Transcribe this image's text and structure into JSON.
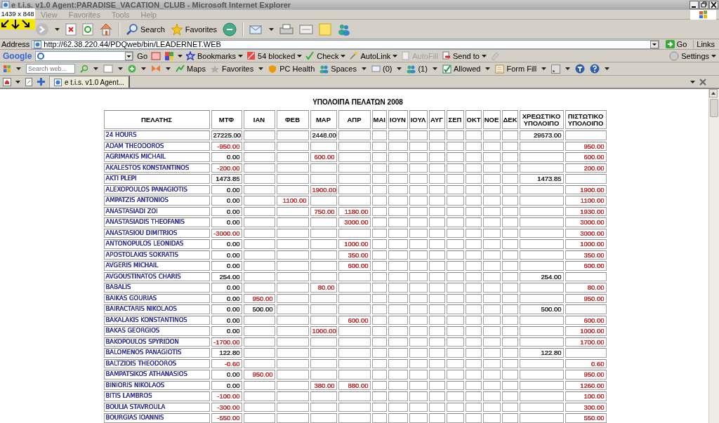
{
  "window": {
    "title": "e t.i.s. v1.0  Agent:PARADISE_VACATION_CLUB - Microsoft Internet Explorer"
  },
  "overlay": {
    "text": "1439 x 848"
  },
  "menu": [
    "View",
    "Favorites",
    "Tools",
    "Help"
  ],
  "toolbar": {
    "buttons": [
      "Search",
      "Favorites"
    ]
  },
  "address": {
    "label": "Address",
    "value": "http://62.38.220.44/PDQweb/bin/LEADERNET.WEB",
    "go": "Go",
    "links": "Links"
  },
  "google_bar": {
    "logo": "Google",
    "go": "Go",
    "items": [
      {
        "label": "Bookmarks",
        "disabled": false
      },
      {
        "label": "54 blocked",
        "disabled": false
      },
      {
        "label": "Check",
        "disabled": false
      },
      {
        "label": "AutoLink",
        "disabled": false
      },
      {
        "label": "AutoFill",
        "disabled": true
      },
      {
        "label": "Send to",
        "disabled": false
      }
    ],
    "settings": "Settings"
  },
  "live_bar": {
    "placeholder": "Search web...",
    "items": [
      "Maps",
      "Favorites",
      "PC Health",
      "Spaces",
      "(0)",
      "(1)",
      "Allowed",
      "Form Fill"
    ]
  },
  "tabs": [
    {
      "label": "e t.i.s. v1.0  Agent...",
      "selected": true
    }
  ],
  "report": {
    "title": "ΥΠΟΛΟΙΠΑ ΠΕΛΑΤΩΝ 2008",
    "columns": [
      "ΠΕΛΑΤΗΣ",
      "ΜΤΦ",
      "ΙΑΝ",
      "ΦΕΒ",
      "ΜΑΡ",
      "ΑΠΡ",
      "ΜΑΙ",
      "ΙΟΥΝ",
      "ΙΟΥΛ",
      "ΑΥΓ",
      "ΣΕΠ",
      "ΟΚΤ",
      "ΝΟΕ",
      "ΔΕΚ",
      "ΧΡΕΩΣΤΙΚΟ ΥΠΟΛΟΙΠΟ",
      "ΠΙΣΤΩΤΙΚΟ ΥΠΟΛΟΙΠΟ"
    ],
    "rows": [
      {
        "cells": [
          {
            "text": "24 HOURS",
            "color": "#3333aa"
          },
          {
            "text": "27225.00",
            "color": "#333333"
          },
          null,
          null,
          {
            "text": "2448.00",
            "color": "#333333"
          },
          null,
          null,
          null,
          null,
          null,
          null,
          null,
          null,
          null,
          {
            "text": "29673.00",
            "color": "#333333"
          },
          null
        ]
      },
      {
        "cells": [
          {
            "text": "ADAM THEODOROS",
            "color": "#3333aa"
          },
          {
            "text": "-950.00",
            "color": "#cc3333"
          },
          null,
          null,
          null,
          null,
          null,
          null,
          null,
          null,
          null,
          null,
          null,
          null,
          null,
          {
            "text": "950.00",
            "color": "#cc3333"
          }
        ]
      },
      {
        "cells": [
          {
            "text": "AGRIMAKIS MICHAIL",
            "color": "#3333aa"
          },
          {
            "text": "0.00",
            "color": "#333333"
          },
          null,
          null,
          {
            "text": "600.00",
            "color": "#cc3333"
          },
          null,
          null,
          null,
          null,
          null,
          null,
          null,
          null,
          null,
          null,
          {
            "text": "600.00",
            "color": "#cc3333"
          }
        ]
      },
      {
        "cells": [
          {
            "text": "AKALESTOS KONSTANTINOS",
            "color": "#3333aa"
          },
          {
            "text": "-200.00",
            "color": "#cc3333"
          },
          null,
          null,
          null,
          null,
          null,
          null,
          null,
          null,
          null,
          null,
          null,
          null,
          null,
          {
            "text": "200.00",
            "color": "#cc3333"
          }
        ]
      },
      {
        "cells": [
          {
            "text": "AKTI PLEPI",
            "color": "#3333aa"
          },
          {
            "text": "1473.85",
            "color": "#333333"
          },
          null,
          null,
          null,
          null,
          null,
          null,
          null,
          null,
          null,
          null,
          null,
          null,
          {
            "text": "1473.85",
            "color": "#333333"
          },
          null
        ]
      },
      {
        "cells": [
          {
            "text": "ALEXOPOULOS PANAGIOTIS",
            "color": "#3333aa"
          },
          {
            "text": "0.00",
            "color": "#333333"
          },
          null,
          null,
          {
            "text": "1900.00",
            "color": "#cc3333"
          },
          null,
          null,
          null,
          null,
          null,
          null,
          null,
          null,
          null,
          null,
          {
            "text": "1900.00",
            "color": "#cc3333"
          }
        ]
      },
      {
        "cells": [
          {
            "text": "AMPATZIS ANTONIOS",
            "color": "#3333aa"
          },
          {
            "text": "0.00",
            "color": "#333333"
          },
          null,
          {
            "text": "1100.00",
            "color": "#cc3333"
          },
          null,
          null,
          null,
          null,
          null,
          null,
          null,
          null,
          null,
          null,
          null,
          {
            "text": "1100.00",
            "color": "#cc3333"
          }
        ]
      },
      {
        "cells": [
          {
            "text": "ANASTASIADI ZOI",
            "color": "#3333aa"
          },
          {
            "text": "0.00",
            "color": "#333333"
          },
          null,
          null,
          {
            "text": "750.00",
            "color": "#cc3333"
          },
          {
            "text": "1180.00",
            "color": "#cc3333"
          },
          null,
          null,
          null,
          null,
          null,
          null,
          null,
          null,
          null,
          {
            "text": "1930.00",
            "color": "#cc3333"
          }
        ]
      },
      {
        "cells": [
          {
            "text": "ANASTASIADIS THEOFANIS",
            "color": "#3333aa"
          },
          {
            "text": "0.00",
            "color": "#333333"
          },
          null,
          null,
          null,
          {
            "text": "3000.00",
            "color": "#cc3333"
          },
          null,
          null,
          null,
          null,
          null,
          null,
          null,
          null,
          null,
          {
            "text": "3000.00",
            "color": "#cc3333"
          }
        ]
      },
      {
        "cells": [
          {
            "text": "ANASTASIOU DIMITRIOS",
            "color": "#3333aa"
          },
          {
            "text": "-3000.00",
            "color": "#cc3333"
          },
          null,
          null,
          null,
          null,
          null,
          null,
          null,
          null,
          null,
          null,
          null,
          null,
          null,
          {
            "text": "3000.00",
            "color": "#cc3333"
          }
        ]
      },
      {
        "cells": [
          {
            "text": "ANTONOPULOS LEONIDAS",
            "color": "#3333aa"
          },
          {
            "text": "0.00",
            "color": "#333333"
          },
          null,
          null,
          null,
          {
            "text": "1000.00",
            "color": "#cc3333"
          },
          null,
          null,
          null,
          null,
          null,
          null,
          null,
          null,
          null,
          {
            "text": "1000.00",
            "color": "#cc3333"
          }
        ]
      },
      {
        "cells": [
          {
            "text": "APOSTOLAKIS SOKRATIS",
            "color": "#3333aa"
          },
          {
            "text": "0.00",
            "color": "#333333"
          },
          null,
          null,
          null,
          {
            "text": "350.00",
            "color": "#cc3333"
          },
          null,
          null,
          null,
          null,
          null,
          null,
          null,
          null,
          null,
          {
            "text": "350.00",
            "color": "#cc3333"
          }
        ]
      },
      {
        "cells": [
          {
            "text": "AVGERIS MICHAIL",
            "color": "#3333aa"
          },
          {
            "text": "0.00",
            "color": "#333333"
          },
          null,
          null,
          null,
          {
            "text": "600.00",
            "color": "#cc3333"
          },
          null,
          null,
          null,
          null,
          null,
          null,
          null,
          null,
          null,
          {
            "text": "600.00",
            "color": "#cc3333"
          }
        ]
      },
      {
        "cells": [
          {
            "text": "AVGOUSTINATOS CHARIS",
            "color": "#3333aa"
          },
          {
            "text": "254.00",
            "color": "#333333"
          },
          null,
          null,
          null,
          null,
          null,
          null,
          null,
          null,
          null,
          null,
          null,
          null,
          {
            "text": "254.00",
            "color": "#333333"
          },
          null
        ]
      },
      {
        "cells": [
          {
            "text": "BABALIS",
            "color": "#3333aa"
          },
          {
            "text": "0.00",
            "color": "#333333"
          },
          null,
          null,
          {
            "text": "80.00",
            "color": "#cc3333"
          },
          null,
          null,
          null,
          null,
          null,
          null,
          null,
          null,
          null,
          null,
          {
            "text": "80.00",
            "color": "#cc3333"
          }
        ]
      },
      {
        "cells": [
          {
            "text": "BAIKAS GOURIAS",
            "color": "#3333aa"
          },
          {
            "text": "0.00",
            "color": "#333333"
          },
          {
            "text": "950.00",
            "color": "#cc3333"
          },
          null,
          null,
          null,
          null,
          null,
          null,
          null,
          null,
          null,
          null,
          null,
          null,
          {
            "text": "950.00",
            "color": "#cc3333"
          }
        ]
      },
      {
        "cells": [
          {
            "text": "BAIRACTARIS NIKOLAOS",
            "color": "#3333aa"
          },
          {
            "text": "0.00",
            "color": "#333333"
          },
          {
            "text": "500.00",
            "color": "#333333"
          },
          null,
          null,
          null,
          null,
          null,
          null,
          null,
          null,
          null,
          null,
          null,
          {
            "text": "500.00",
            "color": "#333333"
          },
          null
        ]
      },
      {
        "cells": [
          {
            "text": "BAKALAKIS KONSTANTINOS",
            "color": "#3333aa"
          },
          {
            "text": "0.00",
            "color": "#333333"
          },
          null,
          null,
          null,
          {
            "text": "600.00",
            "color": "#cc3333"
          },
          null,
          null,
          null,
          null,
          null,
          null,
          null,
          null,
          null,
          {
            "text": "600.00",
            "color": "#cc3333"
          }
        ]
      },
      {
        "cells": [
          {
            "text": "BAKAS GEORGIOS",
            "color": "#3333aa"
          },
          {
            "text": "0.00",
            "color": "#333333"
          },
          null,
          null,
          {
            "text": "1000.00",
            "color": "#cc3333"
          },
          null,
          null,
          null,
          null,
          null,
          null,
          null,
          null,
          null,
          null,
          {
            "text": "1000.00",
            "color": "#cc3333"
          }
        ]
      },
      {
        "cells": [
          {
            "text": "BAKOPOULOS SPYRIDON",
            "color": "#3333aa"
          },
          {
            "text": "-1700.00",
            "color": "#cc3333"
          },
          null,
          null,
          null,
          null,
          null,
          null,
          null,
          null,
          null,
          null,
          null,
          null,
          null,
          {
            "text": "1700.00",
            "color": "#cc3333"
          }
        ]
      },
      {
        "cells": [
          {
            "text": "BALOMENOS PANAGIOTIS",
            "color": "#3333aa"
          },
          {
            "text": "122.80",
            "color": "#333333"
          },
          null,
          null,
          null,
          null,
          null,
          null,
          null,
          null,
          null,
          null,
          null,
          null,
          {
            "text": "122.80",
            "color": "#333333"
          },
          null
        ]
      },
      {
        "cells": [
          {
            "text": "BALTZIDIS THEODOROS",
            "color": "#3333aa"
          },
          {
            "text": "-0.60",
            "color": "#cc3333"
          },
          null,
          null,
          null,
          null,
          null,
          null,
          null,
          null,
          null,
          null,
          null,
          null,
          null,
          {
            "text": "0.60",
            "color": "#cc3333"
          }
        ]
      },
      {
        "cells": [
          {
            "text": "BAMPATSIKOS ATHANASIOS",
            "color": "#3333aa"
          },
          {
            "text": "0.00",
            "color": "#333333"
          },
          {
            "text": "950.00",
            "color": "#cc3333"
          },
          null,
          null,
          null,
          null,
          null,
          null,
          null,
          null,
          null,
          null,
          null,
          null,
          {
            "text": "950.00",
            "color": "#cc3333"
          }
        ]
      },
      {
        "cells": [
          {
            "text": "BINIORIS NIKOLAOS",
            "color": "#3333aa"
          },
          {
            "text": "0.00",
            "color": "#333333"
          },
          null,
          null,
          {
            "text": "380.00",
            "color": "#cc3333"
          },
          {
            "text": "880.00",
            "color": "#cc3333"
          },
          null,
          null,
          null,
          null,
          null,
          null,
          null,
          null,
          null,
          {
            "text": "1260.00",
            "color": "#cc3333"
          }
        ]
      },
      {
        "cells": [
          {
            "text": "BITIS LAMBROS",
            "color": "#3333aa"
          },
          {
            "text": "-100.00",
            "color": "#cc3333"
          },
          null,
          null,
          null,
          null,
          null,
          null,
          null,
          null,
          null,
          null,
          null,
          null,
          null,
          {
            "text": "100.00",
            "color": "#cc3333"
          }
        ]
      },
      {
        "cells": [
          {
            "text": "BOULIA STAVROULA",
            "color": "#3333aa"
          },
          {
            "text": "-300.00",
            "color": "#cc3333"
          },
          null,
          null,
          null,
          null,
          null,
          null,
          null,
          null,
          null,
          null,
          null,
          null,
          null,
          {
            "text": "300.00",
            "color": "#cc3333"
          }
        ]
      },
      {
        "cells": [
          {
            "text": "BOURGIAS IOANNIS",
            "color": "#3333aa"
          },
          {
            "text": "-550.00",
            "color": "#cc3333"
          },
          null,
          null,
          null,
          null,
          null,
          null,
          null,
          null,
          null,
          null,
          null,
          null,
          null,
          {
            "text": "550.00",
            "color": "#cc3333"
          }
        ]
      }
    ]
  }
}
